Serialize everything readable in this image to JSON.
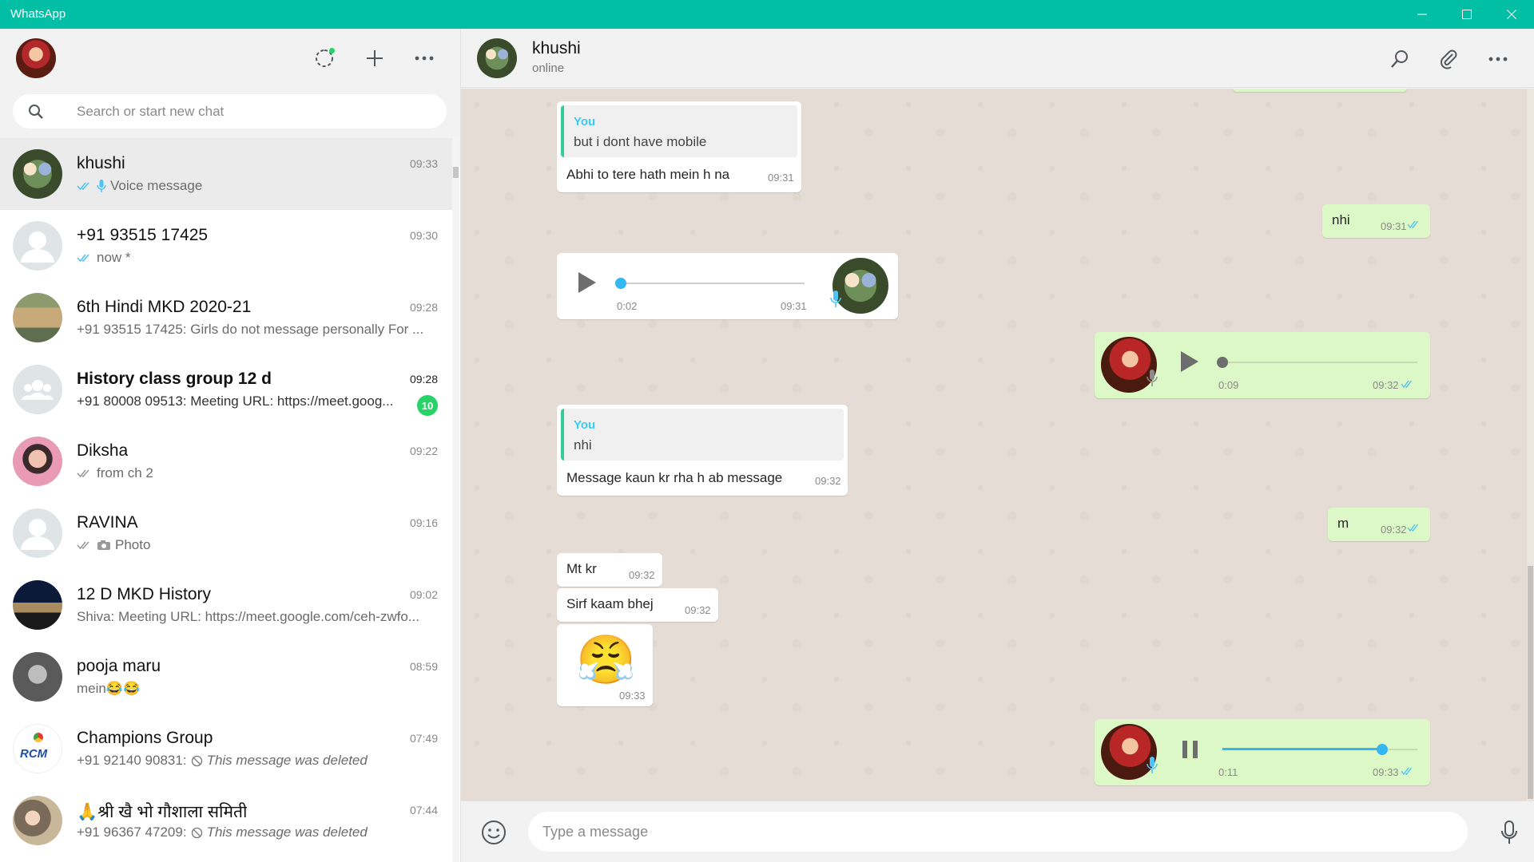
{
  "window": {
    "title": "WhatsApp"
  },
  "sidebar": {
    "search_placeholder": "Search or start new chat",
    "chats": [
      {
        "name": "khushi",
        "time": "09:33",
        "preview": "Voice message",
        "ticks": "read",
        "icon": "mic-icon",
        "avatar": "krishna"
      },
      {
        "name": "+91 93515 17425",
        "time": "09:30",
        "preview": "now *",
        "ticks": "read",
        "avatar": "generic"
      },
      {
        "name": "6th Hindi MKD 2020-21",
        "time": "09:28",
        "preview": "+91 93515 17425: Girls do not message personally  For ...",
        "avatar": "building"
      },
      {
        "name": "History class group 12 d",
        "time": "09:28",
        "preview": "+91 80008 09513: Meeting URL: https://meet.goog...",
        "unread": "10",
        "bold": true,
        "avatar": "group"
      },
      {
        "name": "Diksha",
        "time": "09:22",
        "preview": "from ch 2",
        "ticks": "delivered",
        "avatar": "girl"
      },
      {
        "name": "RAVINA",
        "time": "09:16",
        "preview": "Photo",
        "ticks": "delivered",
        "icon": "camera-icon",
        "avatar": "generic"
      },
      {
        "name": "12 D MKD History",
        "time": "09:02",
        "preview": "Shiva: Meeting URL: https://meet.google.com/ceh-zwfo...",
        "avatar": "night"
      },
      {
        "name": "pooja maru",
        "time": "08:59",
        "preview": "mein😂😂",
        "avatar": "clown"
      },
      {
        "name": "Champions Group",
        "time": "07:49",
        "preview_prefix": "+91 92140 90831: ",
        "preview": "This message was deleted",
        "deleted": true,
        "avatar": "rcm"
      },
      {
        "name": "🙏श्री खै भो गौशाला समिती",
        "time": "07:44",
        "preview_prefix": "+91 96367 47209: ",
        "preview": "This message was deleted",
        "deleted": true,
        "avatar": "cow"
      }
    ]
  },
  "rcm_logo_text": "RCM",
  "chat": {
    "name": "khushi",
    "status": "online",
    "composer_placeholder": "Type a message",
    "messages": {
      "m1": {
        "quote_author": "You",
        "quote_text": "but i dont have mobile",
        "text": "Abhi to tere hath mein h na",
        "time": "09:31"
      },
      "m2": {
        "text": "nhi",
        "time": "09:31"
      },
      "m3": {
        "elapsed": "0:02",
        "time": "09:31",
        "progress": 0
      },
      "m4": {
        "elapsed": "0:09",
        "time": "09:32",
        "progress": 0
      },
      "m5": {
        "quote_author": "You",
        "quote_text": "nhi",
        "text": "Message kaun kr rha h ab message",
        "time": "09:32"
      },
      "m6": {
        "text": "m",
        "time": "09:32"
      },
      "m7": {
        "text": "Mt kr",
        "time": "09:32"
      },
      "m8": {
        "text": "Sirf kaam bhej",
        "time": "09:32"
      },
      "m9": {
        "emoji": "😤",
        "time": "09:33"
      },
      "m10": {
        "elapsed": "0:11",
        "time": "09:33",
        "progress": 0.82,
        "state": "playing"
      }
    }
  },
  "colors": {
    "accent": "#00bfa5",
    "outgoing": "#dcf8c6",
    "chat_bg": "#e5ddd5",
    "read_tick": "#4fc3f7",
    "unread_badge": "#25d366"
  }
}
